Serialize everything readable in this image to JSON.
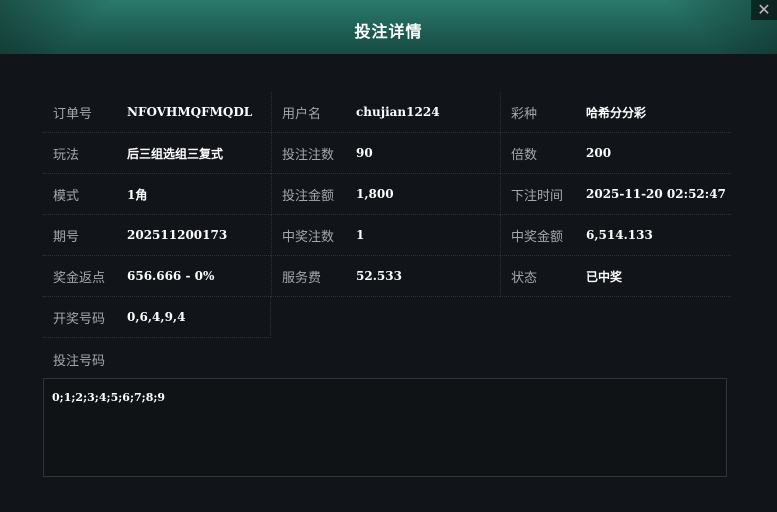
{
  "title": "投注详情",
  "close_glyph": "✕",
  "rows": [
    [
      {
        "label": "订单号",
        "value": "NFOVHMQFMQDL"
      },
      {
        "label": "用户名",
        "value": "chujian1224"
      },
      {
        "label": "彩种",
        "value": "哈希分分彩"
      }
    ],
    [
      {
        "label": "玩法",
        "value": "后三组选组三复式"
      },
      {
        "label": "投注注数",
        "value": "90"
      },
      {
        "label": "倍数",
        "value": "200"
      }
    ],
    [
      {
        "label": "模式",
        "value": "1角"
      },
      {
        "label": "投注金额",
        "value": "1,800"
      },
      {
        "label": "下注时间",
        "value": "2025-11-20 02:52:47"
      }
    ],
    [
      {
        "label": "期号",
        "value": "202511200173"
      },
      {
        "label": "中奖注数",
        "value": "1"
      },
      {
        "label": "中奖金额",
        "value": "6,514.133"
      }
    ],
    [
      {
        "label": "奖金返点",
        "value": "656.666 - 0%"
      },
      {
        "label": "服务费",
        "value": "52.533"
      },
      {
        "label": "状态",
        "value": "已中奖"
      }
    ],
    [
      {
        "label": "开奖号码",
        "value": "0,6,4,9,4"
      }
    ]
  ],
  "bet_numbers_label": "投注号码",
  "bet_numbers": "0;1;2;3;4;5;6;7;8;9"
}
